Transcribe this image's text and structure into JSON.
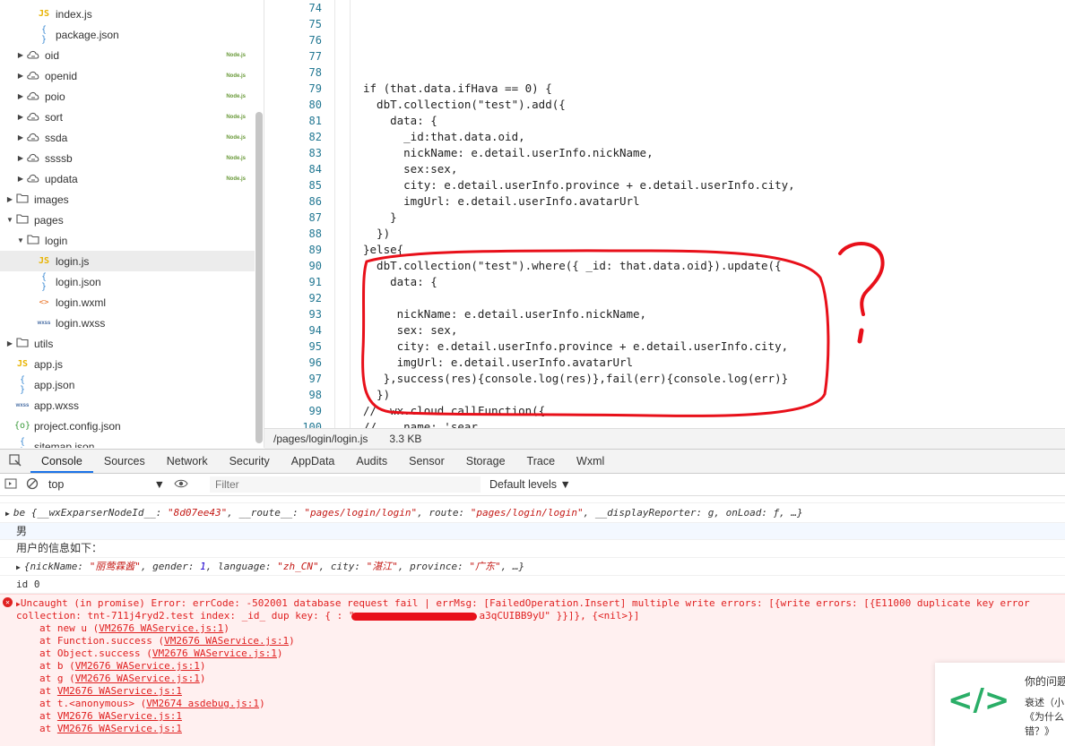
{
  "file_tree": [
    {
      "name": "index.js",
      "icon": "JS",
      "type": "js",
      "indent": 2,
      "arrow": ""
    },
    {
      "name": "package.json",
      "icon": "{ }",
      "type": "json",
      "indent": 2,
      "arrow": ""
    },
    {
      "name": "oid",
      "icon": "☁",
      "type": "cloud",
      "indent": 1,
      "arrow": "▶",
      "badge": "Node.js"
    },
    {
      "name": "openid",
      "icon": "☁",
      "type": "cloud",
      "indent": 1,
      "arrow": "▶",
      "badge": "Node.js"
    },
    {
      "name": "poio",
      "icon": "☁",
      "type": "cloud",
      "indent": 1,
      "arrow": "▶",
      "badge": "Node.js"
    },
    {
      "name": "sort",
      "icon": "☁",
      "type": "cloud",
      "indent": 1,
      "arrow": "▶",
      "badge": "Node.js"
    },
    {
      "name": "ssda",
      "icon": "☁",
      "type": "cloud",
      "indent": 1,
      "arrow": "▶",
      "badge": "Node.js"
    },
    {
      "name": "ssssb",
      "icon": "☁",
      "type": "cloud",
      "indent": 1,
      "arrow": "▶",
      "badge": "Node.js"
    },
    {
      "name": "updata",
      "icon": "☁",
      "type": "cloud",
      "indent": 1,
      "arrow": "▶",
      "badge": "Node.js"
    },
    {
      "name": "images",
      "icon": "▭",
      "type": "folder",
      "indent": 0,
      "arrow": "▶"
    },
    {
      "name": "pages",
      "icon": "▭",
      "type": "folder",
      "indent": 0,
      "arrow": "▼"
    },
    {
      "name": "login",
      "icon": "▭",
      "type": "folder",
      "indent": 1,
      "arrow": "▼"
    },
    {
      "name": "login.js",
      "icon": "JS",
      "type": "js",
      "indent": 2,
      "arrow": "",
      "selected": true
    },
    {
      "name": "login.json",
      "icon": "{ }",
      "type": "json",
      "indent": 2,
      "arrow": ""
    },
    {
      "name": "login.wxml",
      "icon": "<>",
      "type": "wxml",
      "indent": 2,
      "arrow": ""
    },
    {
      "name": "login.wxss",
      "icon": "wxss",
      "type": "wxss",
      "indent": 2,
      "arrow": ""
    },
    {
      "name": "utils",
      "icon": "▭",
      "type": "folder",
      "indent": 0,
      "arrow": "▶"
    },
    {
      "name": "app.js",
      "icon": "JS",
      "type": "js",
      "indent": 0,
      "arrow": ""
    },
    {
      "name": "app.json",
      "icon": "{ }",
      "type": "json",
      "indent": 0,
      "arrow": ""
    },
    {
      "name": "app.wxss",
      "icon": "wxss",
      "type": "wxss",
      "indent": 0,
      "arrow": ""
    },
    {
      "name": "project.config.json",
      "icon": "{o}",
      "type": "config",
      "indent": 0,
      "arrow": ""
    },
    {
      "name": "sitemap.json",
      "icon": "{ }",
      "type": "json",
      "indent": 0,
      "arrow": ""
    }
  ],
  "editor": {
    "lines": [
      {
        "n": "74",
        "code": ""
      },
      {
        "n": "75",
        "code": ""
      },
      {
        "n": "76",
        "code": ""
      },
      {
        "n": "77",
        "code": ""
      },
      {
        "n": "78",
        "code": ""
      },
      {
        "n": "79",
        "code": "if (that.data.ifHava == 0) {"
      },
      {
        "n": "80",
        "code": "  dbT.collection(\"test\").add({"
      },
      {
        "n": "81",
        "code": "    data: {"
      },
      {
        "n": "82",
        "code": "      _id:that.data.oid,"
      },
      {
        "n": "83",
        "code": "      nickName: e.detail.userInfo.nickName,"
      },
      {
        "n": "84",
        "code": "      sex:sex,"
      },
      {
        "n": "85",
        "code": "      city: e.detail.userInfo.province + e.detail.userInfo.city,"
      },
      {
        "n": "86",
        "code": "      imgUrl: e.detail.userInfo.avatarUrl"
      },
      {
        "n": "87",
        "code": "    }"
      },
      {
        "n": "88",
        "code": "  })"
      },
      {
        "n": "89",
        "code": "}else{"
      },
      {
        "n": "90",
        "code": "  dbT.collection(\"test\").where({ _id: that.data.oid}).update({"
      },
      {
        "n": "91",
        "code": "    data: {"
      },
      {
        "n": "92",
        "code": ""
      },
      {
        "n": "93",
        "code": "     nickName: e.detail.userInfo.nickName,"
      },
      {
        "n": "94",
        "code": "     sex: sex,"
      },
      {
        "n": "95",
        "code": "     city: e.detail.userInfo.province + e.detail.userInfo.city,"
      },
      {
        "n": "96",
        "code": "     imgUrl: e.detail.userInfo.avatarUrl"
      },
      {
        "n": "97",
        "code": "   },success(res){console.log(res)},fail(err){console.log(err)}"
      },
      {
        "n": "98",
        "code": "  })"
      },
      {
        "n": "99",
        "code": "//  wx.cloud.callFunction({"
      },
      {
        "n": "100",
        "code": "//    name: 'sear"
      }
    ]
  },
  "editor_status": {
    "path": "/pages/login/login.js",
    "size": "3.3 KB"
  },
  "devtools_tabs": [
    "Console",
    "Sources",
    "Network",
    "Security",
    "AppData",
    "Audits",
    "Sensor",
    "Storage",
    "Trace",
    "Wxml"
  ],
  "console_toolbar": {
    "context": "top",
    "filter_placeholder": "Filter",
    "levels": "Default levels ▼"
  },
  "console": {
    "obj_line": {
      "prefix": "be {__wxExparserNodeId__: ",
      "v1": "\"8d07ee43\"",
      "mid1": ", __route__: ",
      "v2": "\"pages/login/login\"",
      "mid2": ", route: ",
      "v3": "\"pages/login/login\"",
      "tail": ", __displayReporter: g, onLoad: ƒ, …}"
    },
    "gender_text": "男",
    "userinfo_title": "用户的信息如下：",
    "userinfo_obj": {
      "prefix": "{nickName: ",
      "v1": "\"丽莺霖酱\"",
      "mid1": ", gender: ",
      "v2": "1",
      "mid2": ", language: ",
      "v3": "\"zh_CN\"",
      "mid3": ", city: ",
      "v4": "\"湛江\"",
      "mid4": ", province: ",
      "v5": "\"广东\"",
      "tail": ", …}"
    },
    "id_line": "id 0",
    "error_line1": "Uncaught (in promise) Error: errCode: -502001 database request fail | errMsg: [FailedOperation.Insert] multiple write errors: [{write errors: [{E11000 duplicate key error",
    "error_line2": "collection: tnt-711j4ryd2.test index: _id_ dup key: { : \"                     a3qCUIBB9yU\" }}]}, {<nil>}]",
    "stack": [
      {
        "fn": "at new u ",
        "loc": "VM2676 WAService.js:1"
      },
      {
        "fn": "at Function.success ",
        "loc": "VM2676 WAService.js:1"
      },
      {
        "fn": "at Object.success ",
        "loc": "VM2676 WAService.js:1"
      },
      {
        "fn": "at b ",
        "loc": "VM2676 WAService.js:1"
      },
      {
        "fn": "at g ",
        "loc": "VM2676 WAService.js:1"
      },
      {
        "fn": "at ",
        "loc": "VM2676 WAService.js:1"
      },
      {
        "fn": "at t.<anonymous> ",
        "loc": "VM2674 asdebug.js:1"
      },
      {
        "fn": "at ",
        "loc": "VM2676 WAService.js:1"
      },
      {
        "fn": "at ",
        "loc": "VM2676 WAService.js:1"
      }
    ]
  },
  "popup": {
    "logo": "</>",
    "line1": "你的问题",
    "line2": "衰述（小",
    "line3": "《为什么",
    "line4": "错？》"
  },
  "colors": {
    "accent": "#1a73e8",
    "error_text": "#e02020",
    "error_bg": "#fff0f0",
    "annotation": "#e8101a"
  }
}
